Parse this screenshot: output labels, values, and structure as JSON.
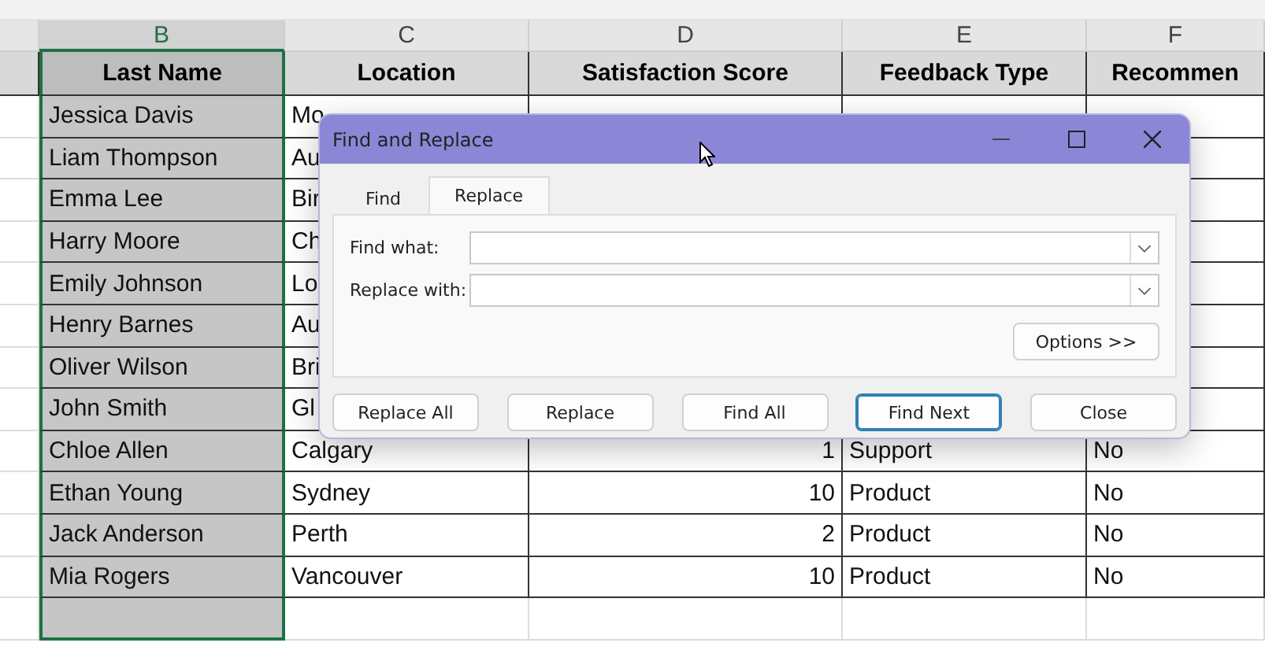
{
  "sheet": {
    "columns": [
      {
        "selected": false,
        "kind": "text"
      },
      {
        "letter": "B",
        "header": "Last Name",
        "selected": true,
        "kind": "text"
      },
      {
        "letter": "C",
        "header": "Location",
        "selected": false,
        "kind": "text"
      },
      {
        "letter": "D",
        "header": "Satisfaction Score",
        "selected": false,
        "kind": "number"
      },
      {
        "letter": "E",
        "header": "Feedback Type",
        "selected": false,
        "kind": "text"
      },
      {
        "letter": "F",
        "header": "Recommen",
        "selected": false,
        "kind": "text"
      }
    ],
    "rows": [
      [
        "",
        "Jessica Davis",
        "Mo",
        "",
        "",
        ""
      ],
      [
        "",
        "Liam Thompson",
        "Au",
        "",
        "",
        ""
      ],
      [
        "",
        "Emma Lee",
        "Bir",
        "",
        "",
        ""
      ],
      [
        "",
        "Harry Moore",
        "Ch",
        "",
        "",
        ""
      ],
      [
        "",
        "Emily Johnson",
        "Lo",
        "",
        "",
        ""
      ],
      [
        "",
        "Henry Barnes",
        "Au",
        "",
        "",
        ""
      ],
      [
        "",
        "Oliver Wilson",
        "Bri",
        "",
        "",
        ""
      ],
      [
        "",
        "John Smith",
        "Gl",
        "",
        "",
        ""
      ],
      [
        "",
        "Chloe Allen",
        "Calgary",
        "1",
        "Support",
        "No"
      ],
      [
        "",
        "Ethan Young",
        "Sydney",
        "10",
        "Product",
        "No"
      ],
      [
        "",
        "Jack Anderson",
        "Perth",
        "2",
        "Product",
        "No"
      ],
      [
        "",
        "Mia Rogers",
        "Vancouver",
        "10",
        "Product",
        "No"
      ],
      [
        "",
        "",
        "",
        "",
        "",
        ""
      ]
    ]
  },
  "dialog": {
    "title": "Find and Replace",
    "tabs": [
      {
        "label": "Find",
        "selected": false
      },
      {
        "label": "Replace",
        "selected": true
      }
    ],
    "fields": [
      {
        "label": "Find what:"
      },
      {
        "label": "Replace with:"
      }
    ],
    "options_button": "Options >>",
    "buttons": [
      {
        "label": "Replace All",
        "focused": false
      },
      {
        "label": "Replace",
        "focused": false
      },
      {
        "label": "Find All",
        "focused": false
      },
      {
        "label": "Find Next",
        "focused": true
      },
      {
        "label": "Close",
        "focused": false
      }
    ]
  }
}
